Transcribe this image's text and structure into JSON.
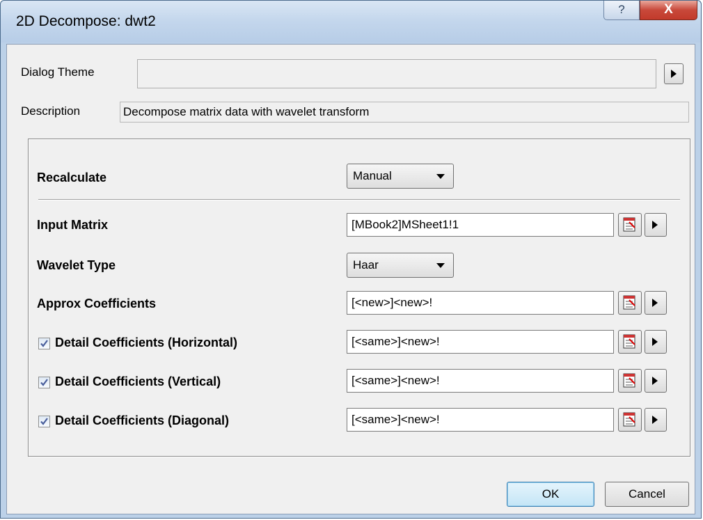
{
  "window": {
    "title": "2D Decompose: dwt2",
    "help_label": "?",
    "close_label": "X"
  },
  "header": {
    "theme_label": "Dialog Theme",
    "theme_value": "",
    "description_label": "Description",
    "description_value": "Decompose matrix data with wavelet transform"
  },
  "form": {
    "recalculate": {
      "label": "Recalculate",
      "value": "Manual"
    },
    "input_matrix": {
      "label": "Input Matrix",
      "value": "[MBook2]MSheet1!1"
    },
    "wavelet_type": {
      "label": "Wavelet Type",
      "value": "Haar"
    },
    "approx": {
      "label": "Approx Coefficients",
      "value": "[<new>]<new>!"
    },
    "horizontal": {
      "label": "Detail Coefficients (Horizontal)",
      "value": "[<same>]<new>!",
      "checked": true
    },
    "vertical": {
      "label": "Detail Coefficients (Vertical)",
      "value": "[<same>]<new>!",
      "checked": true
    },
    "diagonal": {
      "label": "Detail Coefficients (Diagonal)",
      "value": "[<same>]<new>!",
      "checked": true
    }
  },
  "footer": {
    "ok_label": "OK",
    "cancel_label": "Cancel"
  },
  "colors": {
    "title_bar": "#c3d6ec",
    "close_button": "#c8483a",
    "dialog_bg": "#f0f0f0",
    "checkmark": "#4a5f9c"
  }
}
